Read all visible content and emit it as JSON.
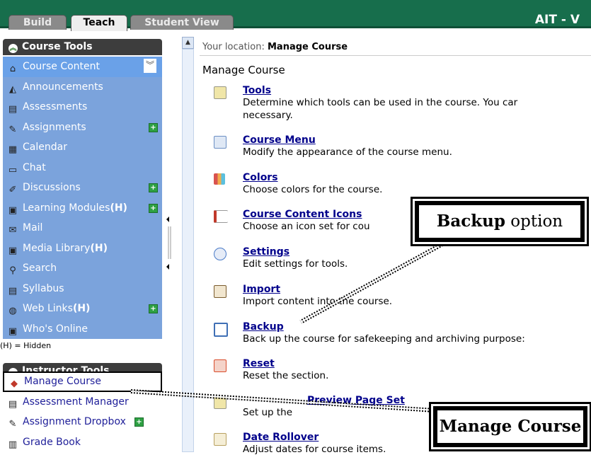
{
  "tabs": [
    {
      "label": "Build",
      "active": false
    },
    {
      "label": "Teach",
      "active": true
    },
    {
      "label": "Student View",
      "active": false
    }
  ],
  "brand": "AIT - V",
  "sidebar": {
    "course_tools_title": "Course Tools",
    "course_tools": [
      {
        "label": "Course Content",
        "icon": "home-icon",
        "plus": false
      },
      {
        "label": "Announcements",
        "icon": "megaphone-icon",
        "plus": false
      },
      {
        "label": "Assessments",
        "icon": "assessment-icon",
        "plus": false
      },
      {
        "label": "Assignments",
        "icon": "assignment-icon",
        "plus": true
      },
      {
        "label": "Calendar",
        "icon": "calendar-icon",
        "plus": false
      },
      {
        "label": "Chat",
        "icon": "chat-icon",
        "plus": false
      },
      {
        "label": "Discussions",
        "icon": "pin-icon",
        "plus": true
      },
      {
        "label": "Learning Modules",
        "suffix": "(H)",
        "icon": "module-icon",
        "plus": true
      },
      {
        "label": "Mail",
        "icon": "mail-icon",
        "plus": false
      },
      {
        "label": "Media Library",
        "suffix": "(H)",
        "icon": "media-icon",
        "plus": false
      },
      {
        "label": "Search",
        "icon": "search-icon",
        "plus": false
      },
      {
        "label": "Syllabus",
        "icon": "syllabus-icon",
        "plus": false
      },
      {
        "label": "Web Links",
        "suffix": "(H)",
        "icon": "globe-icon",
        "plus": true
      },
      {
        "label": "Who's Online",
        "icon": "online-icon",
        "plus": false
      }
    ],
    "hidden_note": "(H) = Hidden",
    "instructor_tools_title": "Instructor Tools",
    "instructor_tools": [
      {
        "label": "Manage Course",
        "icon": "toolbox-icon",
        "plus": false,
        "selected": true
      },
      {
        "label": "Assessment Manager",
        "icon": "assessment-icon",
        "plus": false
      },
      {
        "label": "Assignment Dropbox",
        "icon": "dropbox-icon",
        "plus": true
      },
      {
        "label": "Grade Book",
        "icon": "gradebook-icon",
        "plus": false
      }
    ]
  },
  "content": {
    "location_prefix": "Your location:",
    "location_page": "Manage Course",
    "page_title": "Manage Course",
    "entries": [
      {
        "title": "Tools",
        "desc": "Determine which tools can be used in the course. You car",
        "desc2": "necessary.",
        "icon": "tools-icon",
        "color": "#c9a227"
      },
      {
        "title": "Course Menu",
        "desc": "Modify the appearance of the course menu.",
        "icon": "menu-icon",
        "color": "#6b8fc4"
      },
      {
        "title": "Colors",
        "desc": "Choose colors for the course.",
        "icon": "palette-icon",
        "color": "#d9534f"
      },
      {
        "title": "Course Content Icons",
        "desc": "Choose an icon set for cou",
        "icon": "icons-icon",
        "color": "#c0392b"
      },
      {
        "title": "Settings",
        "desc": "Edit settings for tools.",
        "icon": "settings-icon",
        "color": "#4a7bc8"
      },
      {
        "title": "Import",
        "desc": "Import content into the course.",
        "icon": "import-icon",
        "color": "#7a5c2e"
      },
      {
        "title": "Backup",
        "desc": "Back up the course for safekeeping and archiving purpose:",
        "icon": "backup-icon",
        "color": "#3f6fb5"
      },
      {
        "title": "Reset",
        "desc": "Reset the section.",
        "icon": "reset-icon",
        "color": "#d94c2b"
      },
      {
        "title": "Preview Page Set",
        "desc": "Set up the",
        "icon": "preview-icon",
        "color": "#c9a227"
      },
      {
        "title": "Date Rollover",
        "desc": "Adjust dates for course items.",
        "icon": "calendar-icon",
        "color": "#b8a060"
      }
    ]
  },
  "callouts": {
    "backup_bold": "Backup",
    "backup_rest": " option",
    "manage_course": "Manage Course"
  }
}
